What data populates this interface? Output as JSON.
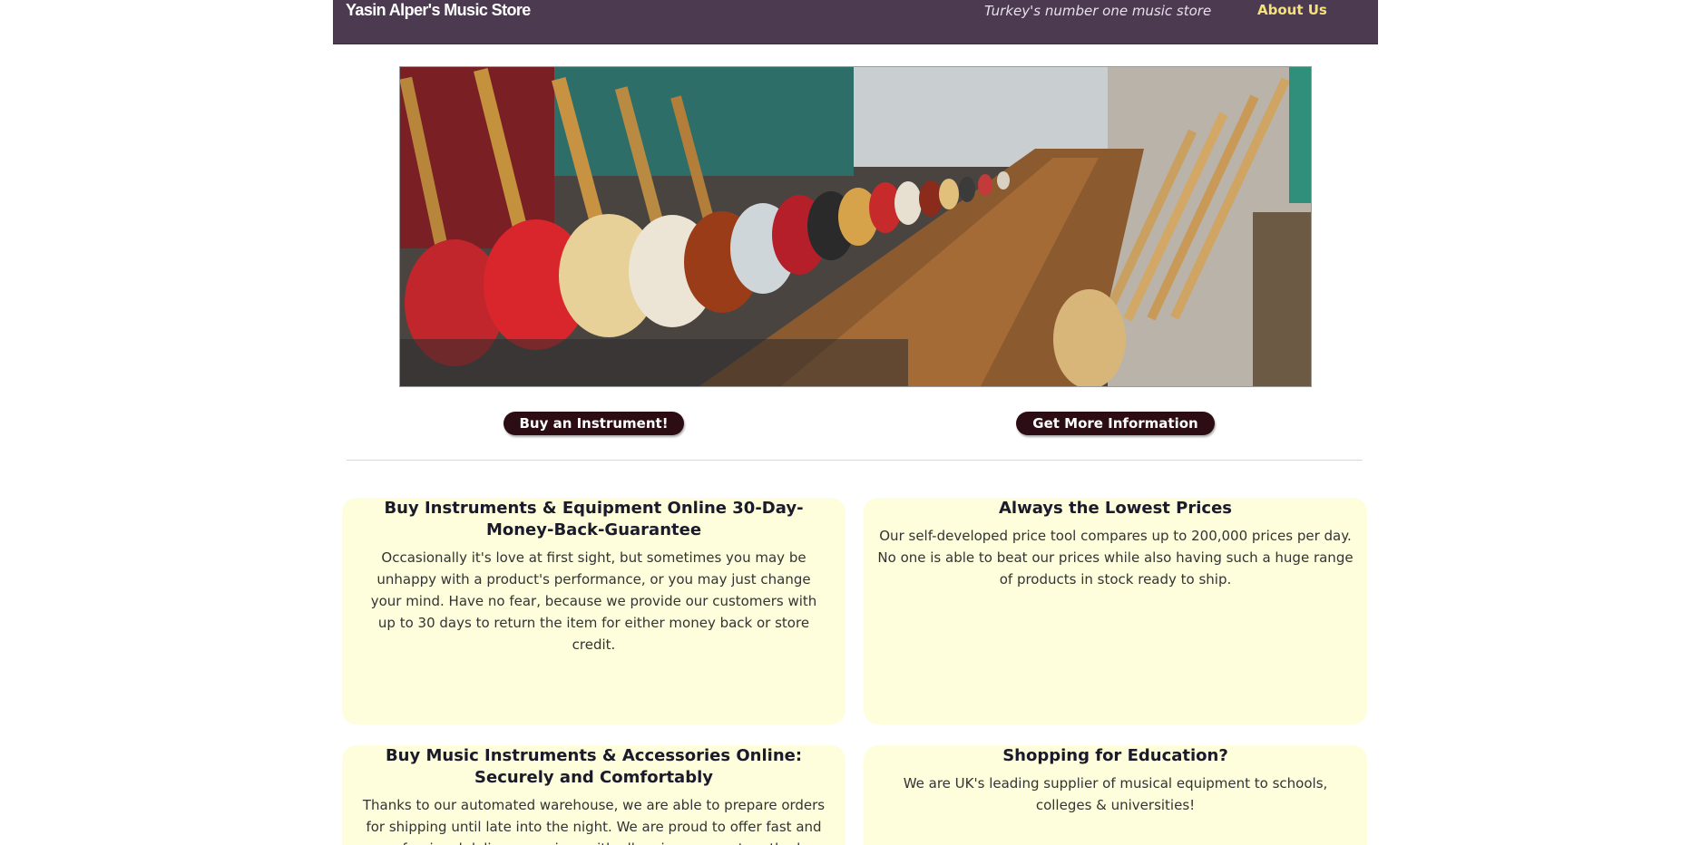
{
  "header": {
    "brand": "Yasin Alper's Music Store",
    "tagline": "Turkey's number one music store",
    "about_link": "About Us"
  },
  "hero": {
    "alt": "Guitar store interior with rows of bass guitars"
  },
  "actions": {
    "buy_label": "Buy an Instrument!",
    "info_label": "Get More Information"
  },
  "cards": [
    {
      "title": "Buy Instruments & Equipment Online 30-Day-Money-Back-Guarantee",
      "body": "Occasionally it's love at first sight, but sometimes you may be unhappy with a product's performance, or you may just change your mind. Have no fear, because we provide our customers with up to 30 days to return the item for either money back or store credit."
    },
    {
      "title": "Always the Lowest Prices",
      "body": "Our self-developed price tool compares up to 200,000 prices per day. No one is able to beat our prices while also having such a huge range of products in stock ready to ship."
    },
    {
      "title": "Buy Music Instruments & Accessories Online: Securely and Comfortably",
      "body": "Thanks to our automated warehouse, we are able to prepare orders for shipping until late into the night. We are proud to offer fast and professional delivery services with all major payment methods available."
    },
    {
      "title": "Shopping for Education?",
      "body": "We are UK's leading supplier of musical equipment to schools, colleges & universities!"
    }
  ],
  "colors": {
    "header_bg": "#4c3a51",
    "accent_link": "#f5e27a",
    "button_bg": "#2c0d13",
    "card_bg": "#fefedc"
  }
}
